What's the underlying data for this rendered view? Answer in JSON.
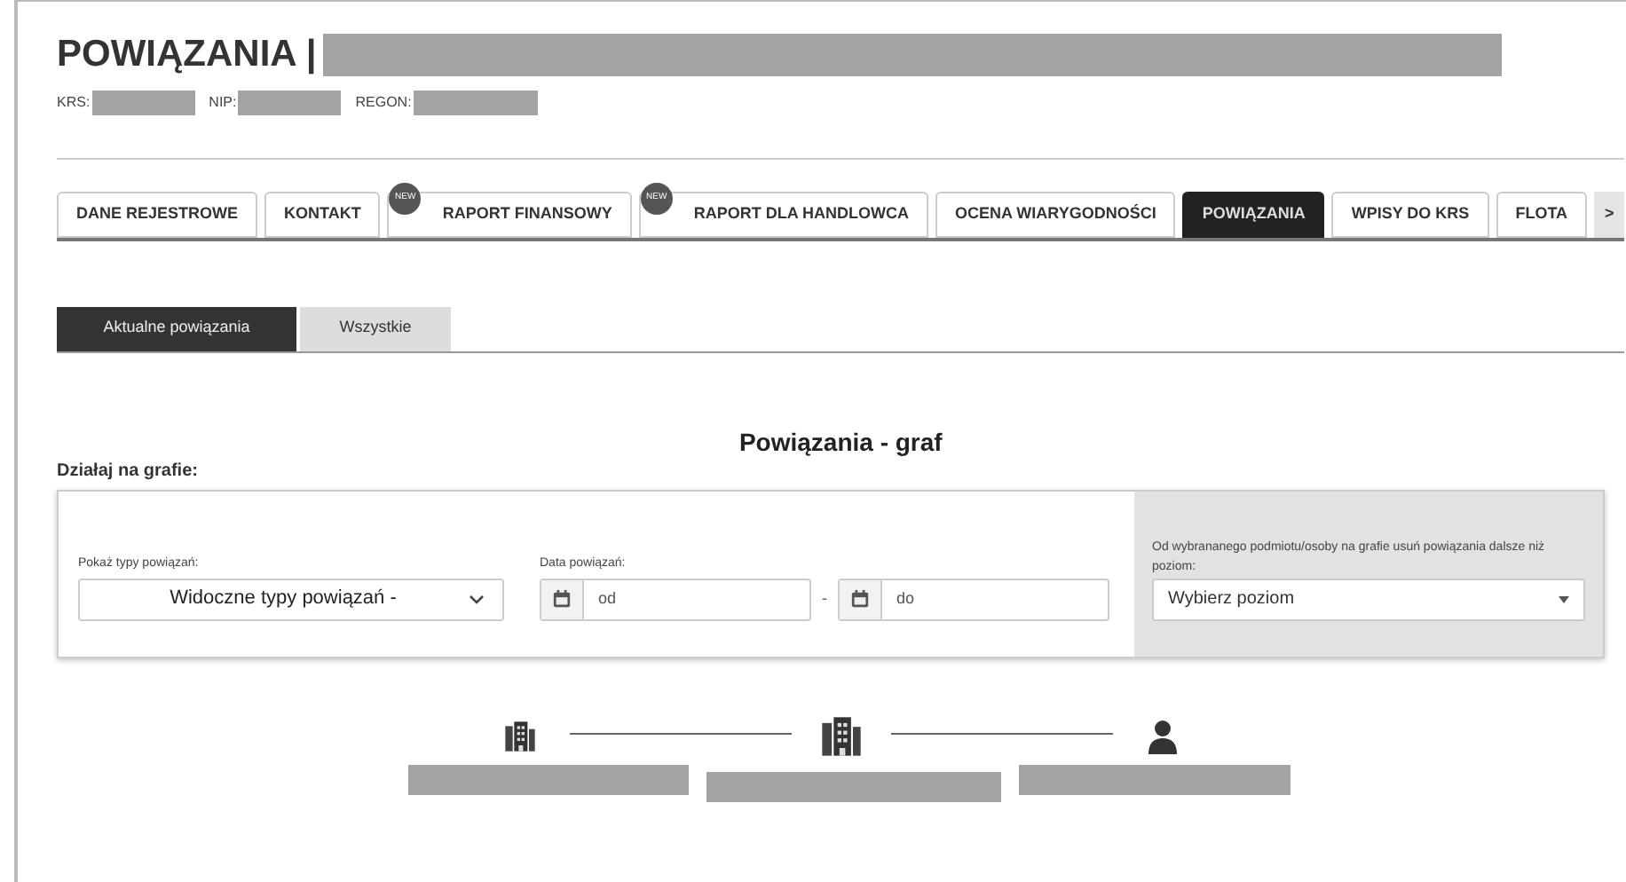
{
  "header": {
    "title": "POWIĄZANIA |",
    "ids": [
      {
        "label": "KRS:"
      },
      {
        "label": "NIP:"
      },
      {
        "label": "REGON:"
      }
    ]
  },
  "tabs": [
    {
      "label": "DANE REJESTROWE",
      "selected": false
    },
    {
      "label": "KONTAKT",
      "selected": false
    },
    {
      "label": "RAPORT FINANSOWY",
      "selected": false,
      "badge": "NEW"
    },
    {
      "label": "RAPORT DLA HANDLOWCA",
      "selected": false,
      "badge": "NEW"
    },
    {
      "label": "OCENA WIARYGODNOŚCI",
      "selected": false
    },
    {
      "label": "POWIĄZANIA",
      "selected": true
    },
    {
      "label": "WPISY DO KRS",
      "selected": false
    },
    {
      "label": "FLOTA",
      "selected": false
    }
  ],
  "tabs_next": ">",
  "subtabs": [
    {
      "label": "Aktualne powiązania",
      "selected": true
    },
    {
      "label": "Wszystkie",
      "selected": false
    }
  ],
  "graph_title": "Powiązania - graf",
  "actions_label": "Działaj na grafie:",
  "filters": {
    "types_label": "Pokaż typy powiązań:",
    "types_value": "Widoczne typy powiązań -",
    "date_label": "Data powiązań:",
    "date_from": "od",
    "date_sep": "-",
    "date_to": "do",
    "level_label": "Od wybrananego podmiotu/osoby na grafie usuń powiązania dalsze niż poziom:",
    "level_value": "Wybierz poziom"
  },
  "graph": {
    "nodes": [
      {
        "kind": "company"
      },
      {
        "kind": "company"
      },
      {
        "kind": "person"
      }
    ]
  }
}
